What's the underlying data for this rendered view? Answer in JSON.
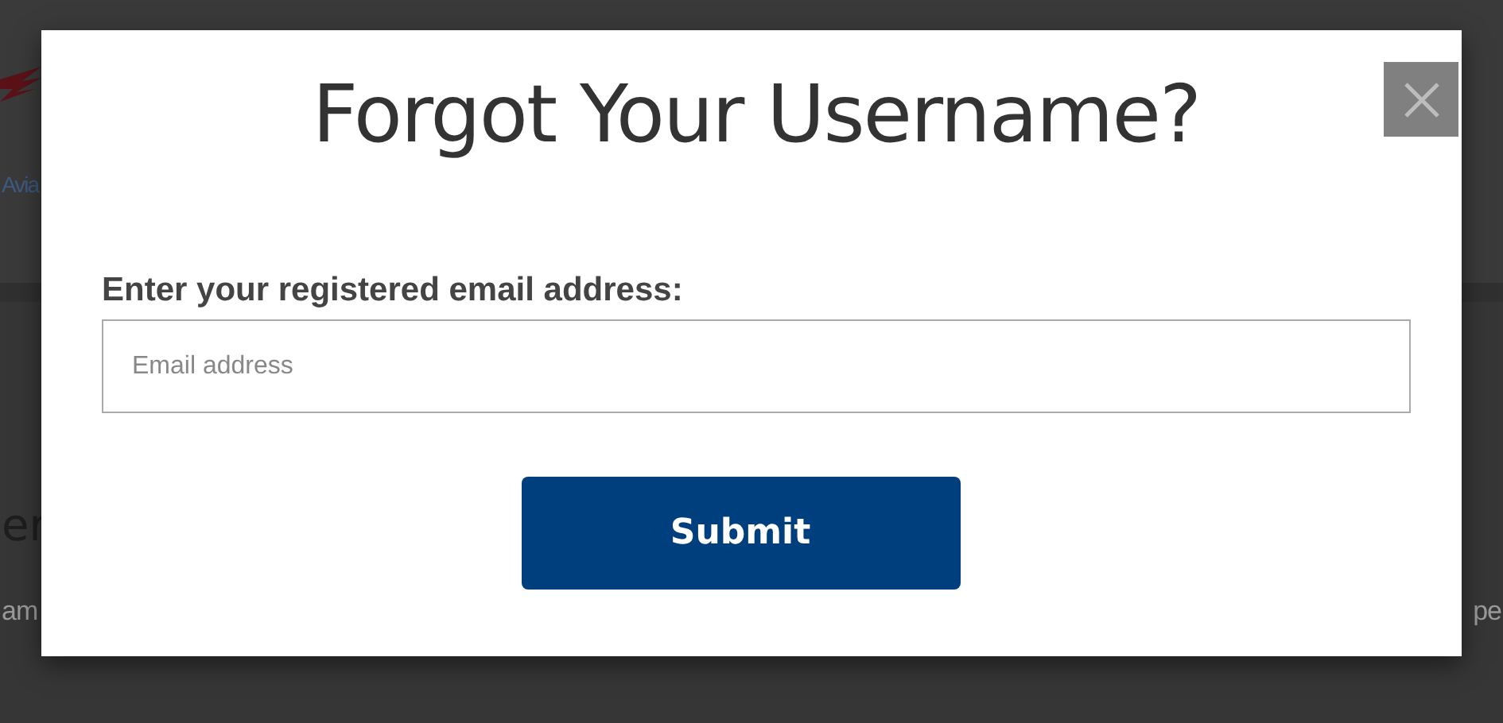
{
  "background": {
    "header_text": "Avia",
    "heading_fragment": "er",
    "line_left_fragment": "am",
    "line_right_fragment": "pe"
  },
  "dialog": {
    "title": "Forgot Your Username?",
    "label": "Enter your registered email address:",
    "email_field": {
      "placeholder": "Email address"
    },
    "submit_button": "Submit"
  }
}
